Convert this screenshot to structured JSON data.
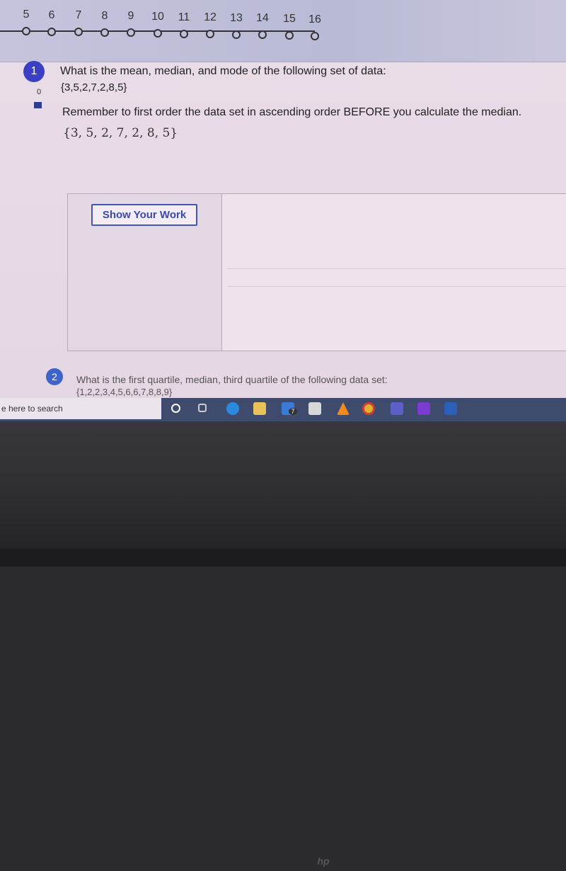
{
  "nav": {
    "numbers": [
      "5",
      "6",
      "7",
      "8",
      "9",
      "10",
      "11",
      "12",
      "13",
      "14",
      "15",
      "16"
    ]
  },
  "question1": {
    "number": "1",
    "score": "0",
    "text": "What is the mean, median, and mode of the following set of data:",
    "set": "{3,5,2,7,2,8,5}",
    "hint": "Remember to first order the data set in ascending order BEFORE you calculate the median.",
    "math": "{3, 5, 2, 7, 2, 8, 5}",
    "show_work_label": "Show Your Work"
  },
  "question2": {
    "number": "2",
    "text": "What is the first quartile, median, third quartile of the following data set:",
    "set": "{1,2,2,3,4,5,6,6,7,8,8,9}"
  },
  "taskbar": {
    "search_placeholder": "e here to search",
    "mail_badge": "7",
    "icons": [
      "cortana-icon",
      "task-view-icon",
      "edge-icon",
      "file-explorer-icon",
      "mail-icon",
      "store-icon",
      "vlc-icon",
      "chrome-icon",
      "teams-icon",
      "twitch-icon",
      "word-icon"
    ]
  },
  "colors": {
    "accent": "#3a3fc4",
    "taskbar": "#3e4b6c",
    "button_border": "#4557b5"
  }
}
